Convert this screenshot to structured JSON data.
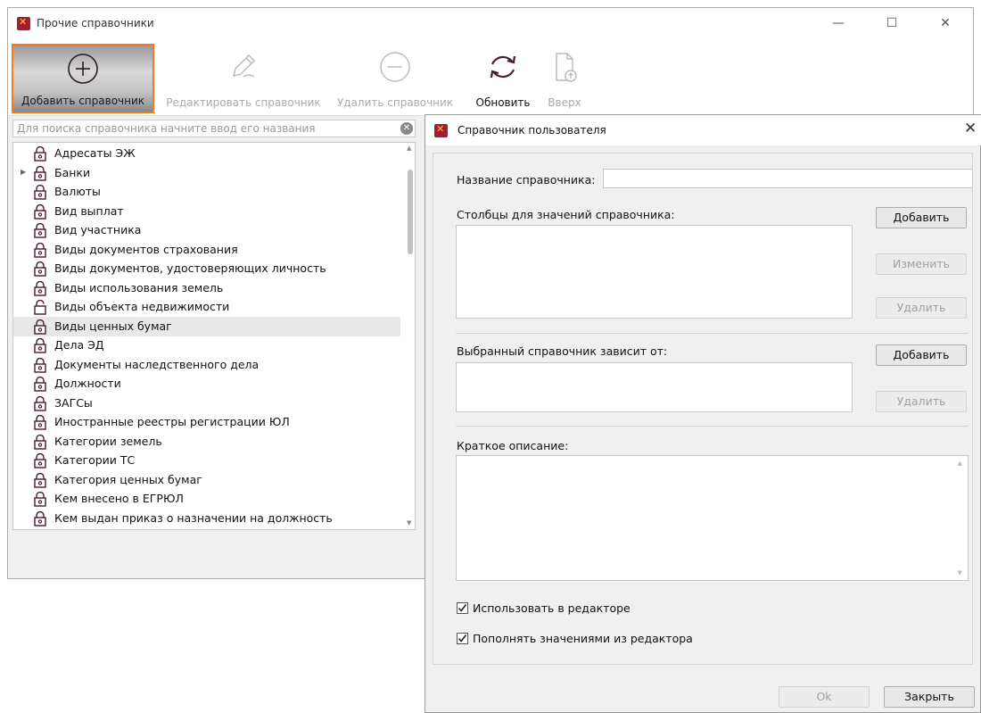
{
  "main_window": {
    "title": "Прочие справочники",
    "controls": {
      "minimize": "—",
      "maximize": "☐",
      "close": "✕"
    }
  },
  "toolbar": {
    "add_label": "Добавить справочник",
    "edit_label": "Редактировать справочник",
    "delete_label": "Удалить справочник",
    "refresh_label": "Обновить",
    "up_label": "Вверх"
  },
  "search": {
    "placeholder": "Для поиска справочника начните ввод его названия",
    "clear_glyph": "✕"
  },
  "list": {
    "items": [
      {
        "label": "Адресаты ЭЖ",
        "locked": true
      },
      {
        "label": "Банки",
        "locked": true,
        "expandable": true
      },
      {
        "label": "Валюты",
        "locked": true
      },
      {
        "label": "Вид выплат",
        "locked": true
      },
      {
        "label": "Вид участника",
        "locked": true
      },
      {
        "label": "Виды документов страхования",
        "locked": true
      },
      {
        "label": "Виды документов, удостоверяющих личность",
        "locked": true
      },
      {
        "label": "Виды использования земель",
        "locked": true
      },
      {
        "label": "Виды объекта недвижимости",
        "locked": false
      },
      {
        "label": "Виды ценных бумаг",
        "locked": true,
        "selected": true
      },
      {
        "label": "Дела ЭД",
        "locked": true
      },
      {
        "label": "Документы наследственного дела",
        "locked": true
      },
      {
        "label": "Должности",
        "locked": true
      },
      {
        "label": "ЗАГСы",
        "locked": true
      },
      {
        "label": "Иностранные реестры регистрации ЮЛ",
        "locked": true
      },
      {
        "label": "Категории земель",
        "locked": true
      },
      {
        "label": "Категории ТС",
        "locked": true
      },
      {
        "label": "Категория ценных бумаг",
        "locked": true
      },
      {
        "label": "Кем внесено в ЕГРЮЛ",
        "locked": true
      },
      {
        "label": "Кем выдан приказ о назначении на должность",
        "locked": true
      }
    ]
  },
  "dialog": {
    "title": "Справочник пользователя",
    "close_glyph": "✕",
    "name_label": "Название справочника:",
    "name_value": "",
    "columns_label": "Столбцы для значений справочника:",
    "columns_add": "Добавить",
    "columns_edit": "Изменить",
    "columns_delete": "Удалить",
    "depends_label": "Выбранный справочник зависит от:",
    "depends_add": "Добавить",
    "depends_delete": "Удалить",
    "description_label": "Краткое описание:",
    "use_in_editor_label": "Использовать в редакторе",
    "use_in_editor_checked": true,
    "fill_from_editor_label": "Пополнять значениями из редактора",
    "fill_from_editor_checked": true,
    "ok_label": "Ok",
    "close_label": "Закрыть"
  },
  "colors": {
    "accent_orange": "#f07c2a",
    "logo_red": "#a61c2f",
    "icon_dark": "#4a1a34"
  }
}
